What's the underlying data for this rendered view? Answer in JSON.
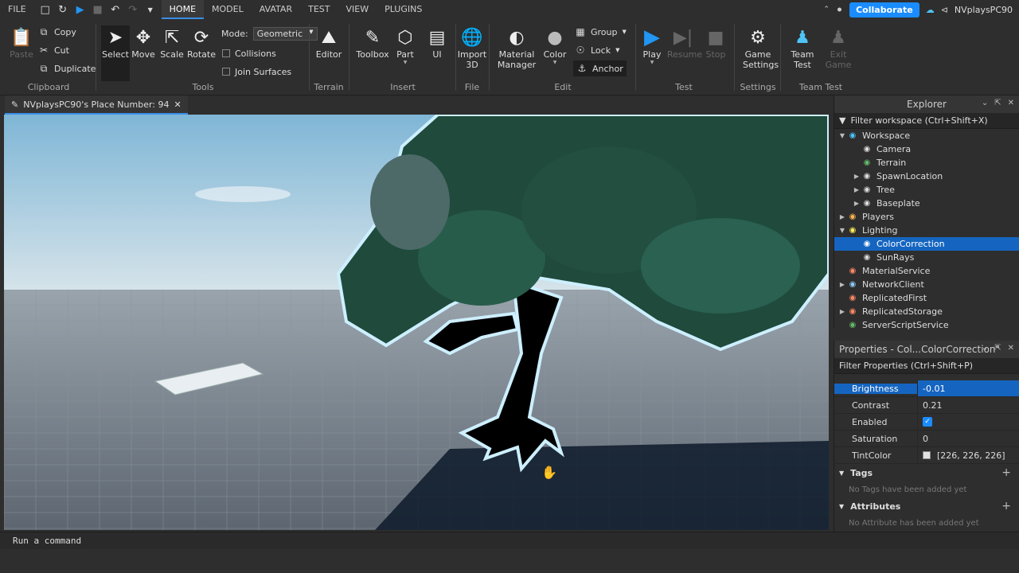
{
  "menubar": {
    "file": "FILE",
    "tabs": [
      "HOME",
      "MODEL",
      "AVATAR",
      "TEST",
      "VIEW",
      "PLUGINS"
    ],
    "active_tab": "HOME",
    "collaborate": "Collaborate",
    "username": "NVplaysPC90"
  },
  "ribbon": {
    "clipboard": {
      "paste": "Paste",
      "copy": "Copy",
      "cut": "Cut",
      "duplicate": "Duplicate",
      "label": "Clipboard"
    },
    "tools": {
      "select": "Select",
      "move": "Move",
      "scale": "Scale",
      "rotate": "Rotate",
      "mode_label": "Mode:",
      "mode_value": "Geometric",
      "collisions": "Collisions",
      "join_surfaces": "Join Surfaces",
      "label": "Tools"
    },
    "terrain": {
      "editor": "Editor",
      "label": "Terrain"
    },
    "insert": {
      "toolbox": "Toolbox",
      "part": "Part",
      "ui": "UI",
      "label": "Insert"
    },
    "file": {
      "import3d_1": "Import",
      "import3d_2": "3D",
      "label": "File"
    },
    "edit": {
      "material_1": "Material",
      "material_2": "Manager",
      "color": "Color",
      "group": "Group",
      "lock": "Lock",
      "anchor": "Anchor",
      "label": "Edit"
    },
    "test": {
      "play": "Play",
      "resume": "Resume",
      "stop": "Stop",
      "label": "Test"
    },
    "settings": {
      "game_1": "Game",
      "game_2": "Settings",
      "label": "Settings"
    },
    "team_test": {
      "team_1": "Team",
      "team_2": "Test",
      "exit_1": "Exit",
      "exit_2": "Game",
      "label": "Team Test"
    }
  },
  "document_tab": {
    "title": "NVplaysPC90's Place Number: 94"
  },
  "explorer": {
    "title": "Explorer",
    "filter_placeholder": "Filter workspace (Ctrl+Shift+X)",
    "items": [
      {
        "label": "Workspace",
        "depth": 0,
        "expanded": "open",
        "icon": "globe-icon",
        "color": "#4fc3f7"
      },
      {
        "label": "Camera",
        "depth": 1,
        "expanded": "none",
        "icon": "camera-icon",
        "color": "#dddddd"
      },
      {
        "label": "Terrain",
        "depth": 1,
        "expanded": "none",
        "icon": "terrain-icon",
        "color": "#66bb6a"
      },
      {
        "label": "SpawnLocation",
        "depth": 1,
        "expanded": "closed",
        "icon": "spawn-icon",
        "color": "#dddddd"
      },
      {
        "label": "Tree",
        "depth": 1,
        "expanded": "closed",
        "icon": "model-icon",
        "color": "#dddddd"
      },
      {
        "label": "Baseplate",
        "depth": 1,
        "expanded": "closed",
        "icon": "part-icon",
        "color": "#dddddd"
      },
      {
        "label": "Players",
        "depth": 0,
        "expanded": "closed",
        "icon": "players-icon",
        "color": "#ffb74d"
      },
      {
        "label": "Lighting",
        "depth": 0,
        "expanded": "open",
        "icon": "bulb-icon",
        "color": "#ffee58"
      },
      {
        "label": "ColorCorrection",
        "depth": 1,
        "expanded": "none",
        "icon": "color-correction-icon",
        "color": "#ffffff",
        "selected": true
      },
      {
        "label": "SunRays",
        "depth": 1,
        "expanded": "none",
        "icon": "sunrays-icon",
        "color": "#dddddd"
      },
      {
        "label": "MaterialService",
        "depth": 0,
        "expanded": "none",
        "icon": "material-icon",
        "color": "#ff8a65"
      },
      {
        "label": "NetworkClient",
        "depth": 0,
        "expanded": "closed",
        "icon": "network-icon",
        "color": "#90caf9"
      },
      {
        "label": "ReplicatedFirst",
        "depth": 0,
        "expanded": "none",
        "icon": "replicated-icon",
        "color": "#ff8a65"
      },
      {
        "label": "ReplicatedStorage",
        "depth": 0,
        "expanded": "closed",
        "icon": "storage-icon",
        "color": "#ff8a65"
      },
      {
        "label": "ServerScriptService",
        "depth": 0,
        "expanded": "none",
        "icon": "script-service-icon",
        "color": "#66bb6a"
      }
    ]
  },
  "properties": {
    "title": "Properties - Col...ColorCorrection\"",
    "filter_placeholder": "Filter Properties (Ctrl+Shift+P)",
    "rows": [
      {
        "name": "Brightness",
        "value": "-0.01",
        "selected": true
      },
      {
        "name": "Contrast",
        "value": "0.21"
      },
      {
        "name": "Enabled",
        "value": "",
        "checkbox": true
      },
      {
        "name": "Saturation",
        "value": "0"
      },
      {
        "name": "TintColor",
        "value": "[226, 226, 226]",
        "swatch": "#e2e2e2"
      }
    ],
    "tags": {
      "title": "Tags",
      "empty": "No Tags have been added yet"
    },
    "attributes": {
      "title": "Attributes",
      "empty": "No Attribute has been added yet"
    }
  },
  "command_bar": {
    "placeholder": "Run a command"
  },
  "colors": {
    "accent": "#1a8cff",
    "selection": "#1565c0",
    "play": "#2196f3"
  }
}
